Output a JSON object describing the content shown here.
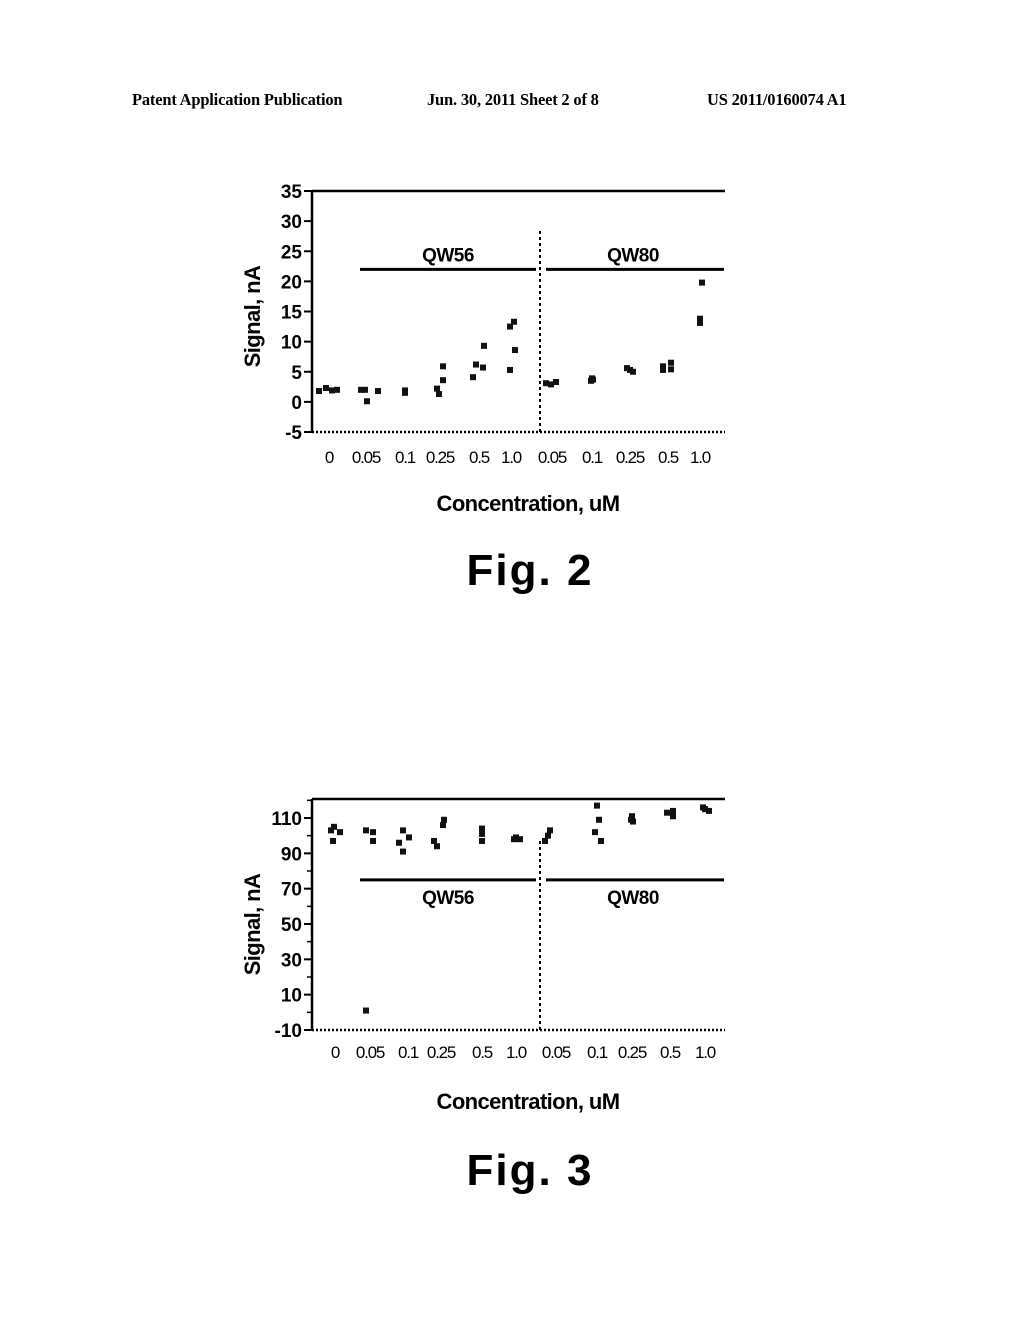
{
  "header": {
    "left": "Patent Application Publication",
    "middle": "Jun. 30, 2011  Sheet 2 of 8",
    "right": "US 2011/0160074 A1"
  },
  "chart_data": [
    {
      "type": "scatter",
      "caption": "Fig. 2",
      "title": "",
      "xlabel": "Concentration, uM",
      "ylabel": "Signal, nA",
      "ylim": [
        -5,
        35
      ],
      "yticks": [
        "35",
        "30",
        "25",
        "20",
        "15",
        "10",
        "5",
        "0",
        "-5"
      ],
      "ytick_values": [
        35,
        30,
        25,
        20,
        15,
        10,
        5,
        0,
        -5
      ],
      "categories": [
        "0",
        "0.05",
        "0.1",
        "0.25",
        "0.5",
        "1.0",
        "0.05",
        "0.1",
        "0.25",
        "0.5",
        "1.0"
      ],
      "groups": [
        {
          "label": "QW56",
          "from_category": 1,
          "to_category": 5,
          "line_value": 22
        },
        {
          "label": "QW80",
          "from_category": 6,
          "to_category": 10,
          "line_value": 22
        }
      ],
      "divider_after_category": 5,
      "grid": false,
      "series": [
        {
          "name": "0",
          "category": 0,
          "values": [
            1.8,
            2.3,
            1.9,
            2.0
          ]
        },
        {
          "name": "0.05 (QW56)",
          "category": 1,
          "values": [
            2.0,
            0.1,
            1.8,
            2.0
          ]
        },
        {
          "name": "0.1 (QW56)",
          "category": 2,
          "values": [
            1.5,
            1.9,
            1.6
          ]
        },
        {
          "name": "0.25 (QW56)",
          "category": 3,
          "values": [
            2.2,
            1.3,
            3.6,
            5.9
          ]
        },
        {
          "name": "0.5 (QW56)",
          "category": 4,
          "values": [
            6.2,
            4.1,
            5.7,
            9.3
          ]
        },
        {
          "name": "1.0 (QW56)",
          "category": 5,
          "values": [
            12.5,
            5.3,
            8.6,
            13.3
          ]
        },
        {
          "name": "0.05 (QW80)",
          "category": 6,
          "values": [
            3.1,
            2.9,
            3.3
          ]
        },
        {
          "name": "0.1 (QW80)",
          "category": 7,
          "values": [
            3.5,
            3.9,
            3.7
          ]
        },
        {
          "name": "0.25 (QW80)",
          "category": 8,
          "values": [
            5.6,
            5.0,
            5.3
          ]
        },
        {
          "name": "0.5 (QW80)",
          "category": 9,
          "values": [
            5.9,
            5.3,
            6.5,
            5.4
          ]
        },
        {
          "name": "1.0 (QW80)",
          "category": 10,
          "values": [
            19.8,
            13.8,
            13.1
          ]
        }
      ]
    },
    {
      "type": "scatter",
      "caption": "Fig. 3",
      "title": "",
      "xlabel": "Concentration, uM",
      "ylabel": "Signal, nA",
      "ylim": [
        -10,
        120
      ],
      "yticks": [
        "110",
        "90",
        "70",
        "50",
        "30",
        "10",
        "-10"
      ],
      "ytick_values": [
        110,
        90,
        70,
        50,
        30,
        10,
        -10
      ],
      "categories": [
        "0",
        "0.05",
        "0.1",
        "0.25",
        "0.5",
        "1.0",
        "0.05",
        "0.1",
        "0.25",
        "0.5",
        "1.0"
      ],
      "groups": [
        {
          "label": "QW56",
          "from_category": 1,
          "to_category": 5,
          "line_value": 75
        },
        {
          "label": "QW80",
          "from_category": 6,
          "to_category": 10,
          "line_value": 75
        }
      ],
      "divider_after_category": 5,
      "grid": false,
      "series": [
        {
          "name": "0",
          "category": 0,
          "values": [
            103,
            105,
            97,
            102
          ]
        },
        {
          "name": "0.05 (QW56)",
          "category": 1,
          "values": [
            103,
            1,
            102,
            97
          ]
        },
        {
          "name": "0.1 (QW56)",
          "category": 2,
          "values": [
            96,
            103,
            91,
            99
          ]
        },
        {
          "name": "0.25 (QW56)",
          "category": 3,
          "values": [
            97,
            94,
            106,
            109
          ]
        },
        {
          "name": "0.5 (QW56)",
          "category": 4,
          "values": [
            104,
            101,
            97
          ]
        },
        {
          "name": "1.0 (QW56)",
          "category": 5,
          "values": [
            98,
            99,
            98
          ]
        },
        {
          "name": "0.05 (QW80)",
          "category": 6,
          "values": [
            97,
            100,
            103
          ]
        },
        {
          "name": "0.1 (QW80)",
          "category": 7,
          "values": [
            117,
            109,
            102,
            97
          ]
        },
        {
          "name": "0.25 (QW80)",
          "category": 8,
          "values": [
            109,
            111,
            108
          ]
        },
        {
          "name": "0.5 (QW80)",
          "category": 9,
          "values": [
            113,
            111,
            114
          ]
        },
        {
          "name": "1.0 (QW80)",
          "category": 10,
          "values": [
            116,
            115,
            114
          ]
        }
      ]
    }
  ]
}
